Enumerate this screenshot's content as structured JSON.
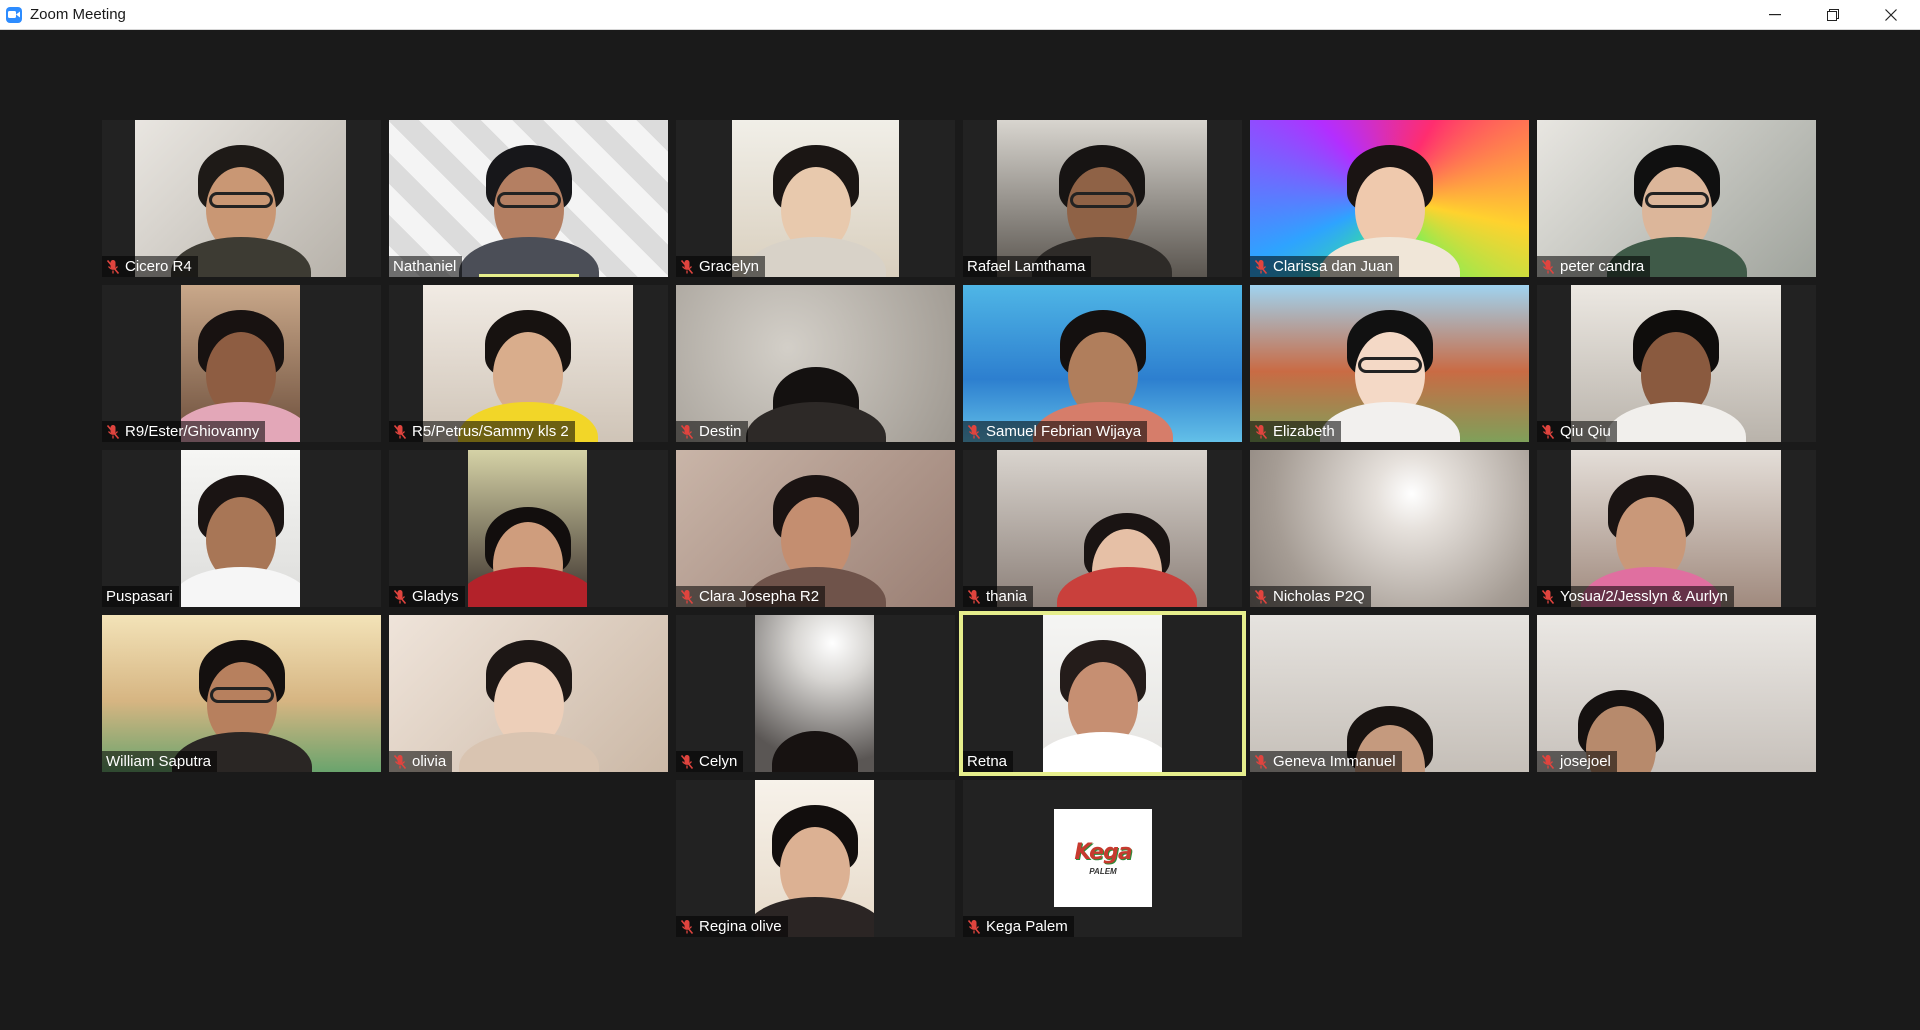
{
  "window": {
    "title": "Zoom Meeting",
    "controls": {
      "minimize": "—",
      "restore": "❐",
      "close": "✕"
    }
  },
  "colors": {
    "active_speaker_border": "#e6ee8c",
    "muted_icon": "#e0443e",
    "app_blue": "#2d8cff"
  },
  "participants": [
    {
      "name": "Cicero R4",
      "muted": true
    },
    {
      "name": "Nathaniel",
      "muted": false
    },
    {
      "name": "Gracelyn",
      "muted": true
    },
    {
      "name": "Rafael Lamthama",
      "muted": false
    },
    {
      "name": "Clarissa dan Juan",
      "muted": true
    },
    {
      "name": "peter candra",
      "muted": true
    },
    {
      "name": "R9/Ester/Ghiovanny",
      "muted": true
    },
    {
      "name": "R5/Petrus/Sammy kls 2",
      "muted": true
    },
    {
      "name": "Destin",
      "muted": true
    },
    {
      "name": "Samuel Febrian Wijaya",
      "muted": true
    },
    {
      "name": "Elizabeth",
      "muted": true
    },
    {
      "name": "Qiu Qiu",
      "muted": true
    },
    {
      "name": "Puspasari",
      "muted": false
    },
    {
      "name": "Gladys",
      "muted": true
    },
    {
      "name": "Clara Josepha R2",
      "muted": true
    },
    {
      "name": "thania",
      "muted": true
    },
    {
      "name": "Nicholas P2Q",
      "muted": true
    },
    {
      "name": "Yosua/2/Jesslyn & Aurlyn",
      "muted": true
    },
    {
      "name": "William Saputra",
      "muted": false
    },
    {
      "name": "olivia",
      "muted": true
    },
    {
      "name": "Celyn",
      "muted": true
    },
    {
      "name": "Retna",
      "muted": false,
      "active_speaker": true
    },
    {
      "name": "Geneva Immanuel",
      "muted": true
    },
    {
      "name": "josejoel",
      "muted": true
    },
    {
      "name": "Regina olive",
      "muted": true
    },
    {
      "name": "Kega Palem",
      "muted": true,
      "logo_text": "Kega",
      "logo_sub": "PALEM"
    }
  ]
}
